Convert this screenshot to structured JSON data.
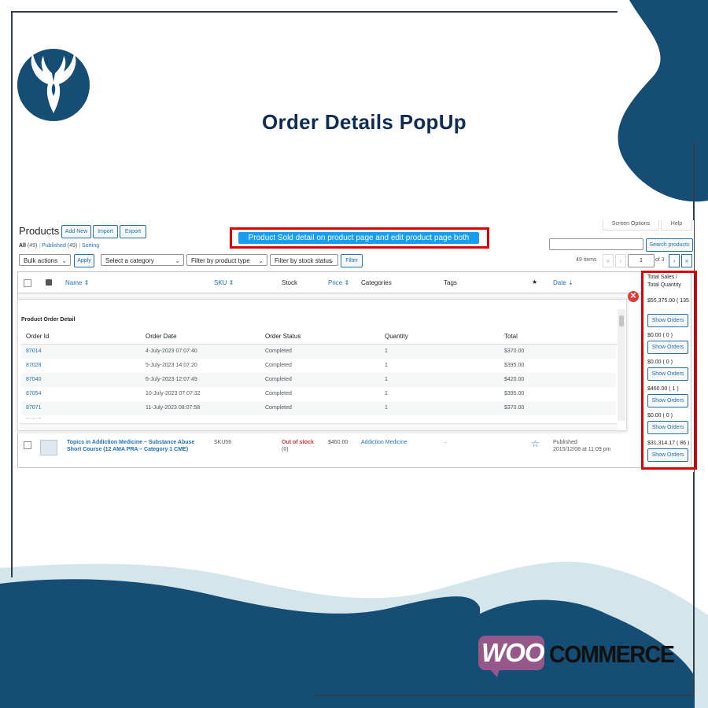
{
  "headline": "Order Details PopUp",
  "callout": "Product Sold detail on product page and edit product page both",
  "admin": {
    "page_title": "Products",
    "buttons": {
      "add_new": "Add New",
      "import": "Import",
      "export": "Export"
    },
    "top_right": {
      "screen_options": "Screen Options",
      "help": "Help"
    },
    "subsubsub": {
      "all": "All",
      "all_count": "(49)",
      "published": "Published",
      "published_count": "(49)",
      "sorting": "Sorting"
    },
    "search": {
      "value": "",
      "button": "Search products"
    },
    "filters": {
      "bulk_actions": "Bulk actions",
      "apply": "Apply",
      "category": "Select a category",
      "product_type": "Filter by product type",
      "stock_status": "Filter by stock status",
      "filter": "Filter"
    },
    "pagination": {
      "items": "49 items",
      "first": "«",
      "prev": "‹",
      "current": "1",
      "of": "of 3",
      "next": "›",
      "last": "»"
    },
    "columns": {
      "name": "Name ⇕",
      "sku": "SKU ⇕",
      "stock": "Stock",
      "price": "Price ⇕",
      "categories": "Categories",
      "tags": "Tags",
      "featured": "★",
      "date": "Date ⇣",
      "total_sales": "Total Sales /",
      "total_quantity": "Total Quantity"
    },
    "popup": {
      "title": "Product Order Detail",
      "headers": {
        "order_id": "Order Id",
        "order_date": "Order Date",
        "order_status": "Order Status",
        "quantity": "Quantity",
        "total": "Total"
      },
      "rows": [
        {
          "id": "87014",
          "date": "4-July-2023 07:07:40",
          "status": "Completed",
          "qty": "1",
          "total": "$370.00"
        },
        {
          "id": "87028",
          "date": "5-July-2023 14:07:20",
          "status": "Completed",
          "qty": "1",
          "total": "$395.00"
        },
        {
          "id": "87040",
          "date": "6-July-2023 12:07:49",
          "status": "Completed",
          "qty": "1",
          "total": "$420.00"
        },
        {
          "id": "87054",
          "date": "10-July-2023 07:07:32",
          "status": "Completed",
          "qty": "1",
          "total": "$395.00"
        },
        {
          "id": "87071",
          "date": "11-July-2023 08:07:58",
          "status": "Completed",
          "qty": "1",
          "total": "$370.00"
        }
      ]
    },
    "product": {
      "name_line1": "Topics in Addiction Medicine – Substance Abuse",
      "name_line2": "Short Course (12 AMA PRA – Category 1 CME)",
      "sku": "SKU56",
      "stock": "Out of stock",
      "stock_qty": "(0)",
      "price": "$460.00",
      "category": "Addiction Medicine",
      "tags": "–",
      "status": "Published",
      "date": "2015/12/08 at 11:09 pm"
    },
    "sales": [
      {
        "value": "$55,375.00 ( 135 )",
        "button": "Show Orders"
      },
      {
        "value": "$0.00 ( 0 )",
        "button": "Show Orders"
      },
      {
        "value": "$0.00 ( 0 )",
        "button": "Show Orders"
      },
      {
        "value": "$460.00 ( 1 )",
        "button": "Show Orders"
      },
      {
        "value": "$0.00 ( 0 )",
        "button": "Show Orders"
      },
      {
        "value": "$31,314.17 ( 86 )",
        "button": "Show Orders"
      }
    ]
  },
  "brand": {
    "woo": "WOO",
    "commerce": "COMMERCE"
  },
  "colors": {
    "navy": "#154d74",
    "light_blue": "#d4e6ec",
    "wp_blue": "#2271b1",
    "highlight_red": "#e00000",
    "woo_purple": "#96588a"
  }
}
